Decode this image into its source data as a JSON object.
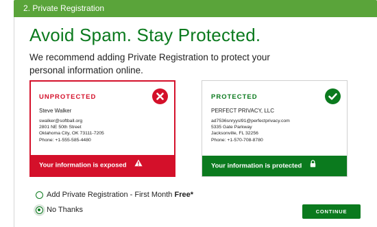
{
  "step": {
    "title": "2. Private Registration"
  },
  "main": {
    "headline": "Avoid Spam. Stay Protected.",
    "subtext": "We recommend adding Private Registration to protect your personal information online."
  },
  "cards": {
    "unprotected": {
      "title": "UNPROTECTED",
      "name": "Steve Walker",
      "email": "swalker@softball.org",
      "address1": "2801 NE 50th Street",
      "address2": "Oklahoma City, OK 73111-7205",
      "phone": "Phone: +1-555-585-4480",
      "status": "Your information is exposed",
      "badge_icon": "close-icon",
      "status_icon": "warning-icon"
    },
    "protected": {
      "title": "PROTECTED",
      "name": "PERFECT PRIVACY, LLC",
      "email": "ad7536snryysl91@perfectprivacy.com",
      "address1": "5335 Gate Parkway",
      "address2": "Jacksonville, FL 32256",
      "phone": "Phone: +1-570-708-8780",
      "status": "Your information is protected",
      "badge_icon": "check-icon",
      "status_icon": "lock-icon"
    }
  },
  "options": {
    "add_label": "Add Private Registration - First Month ",
    "add_label_bold": "Free*",
    "no_thanks_label": "No Thanks",
    "selected": "no_thanks"
  },
  "actions": {
    "continue_label": "CONTINUE"
  },
  "colors": {
    "brand_green": "#0b7a1e",
    "header_green": "#5aa43a",
    "alert_red": "#d4102a"
  }
}
